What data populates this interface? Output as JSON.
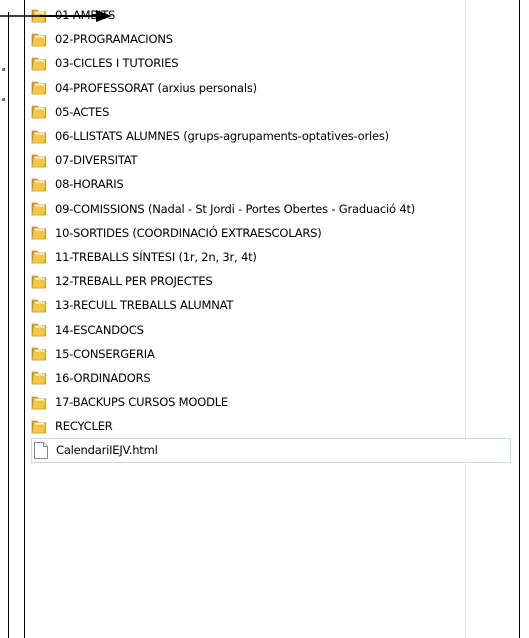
{
  "explorer": {
    "items": [
      {
        "name": "01-AMBITS",
        "type": "folder"
      },
      {
        "name": "02-PROGRAMACIONS",
        "type": "folder"
      },
      {
        "name": "03-CICLES I TUTORIES",
        "type": "folder"
      },
      {
        "name": "04-PROFESSORAT (arxius personals)",
        "type": "folder"
      },
      {
        "name": "05-ACTES",
        "type": "folder"
      },
      {
        "name": "06-LLISTATS ALUMNES (grups-agrupaments-optatives-orles)",
        "type": "folder"
      },
      {
        "name": "07-DIVERSITAT",
        "type": "folder"
      },
      {
        "name": "08-HORARIS",
        "type": "folder"
      },
      {
        "name": "09-COMISSIONS (Nadal - St Jordi - Portes Obertes - Graduació 4t)",
        "type": "folder"
      },
      {
        "name": "10-SORTIDES (COORDINACIÓ EXTRAESCOLARS)",
        "type": "folder"
      },
      {
        "name": "11-TREBALLS SÍNTESI (1r, 2n, 3r, 4t)",
        "type": "folder"
      },
      {
        "name": "12-TREBALL PER PROJECTES",
        "type": "folder"
      },
      {
        "name": "13-RECULL TREBALLS ALUMNAT",
        "type": "folder"
      },
      {
        "name": "14-ESCANDOCS",
        "type": "folder"
      },
      {
        "name": "15-CONSERGERIA",
        "type": "folder"
      },
      {
        "name": "16-ORDINADORS",
        "type": "folder"
      },
      {
        "name": "17-BACKUPS CURSOS MOODLE",
        "type": "folder"
      },
      {
        "name": "RECYCLER",
        "type": "folder"
      },
      {
        "name": "CalendariIEJV.html",
        "type": "file",
        "selected": true
      }
    ],
    "colors": {
      "folder_body": "#f2c744",
      "folder_back": "#d9a21c",
      "selection_border": "#d0dbe8"
    }
  }
}
